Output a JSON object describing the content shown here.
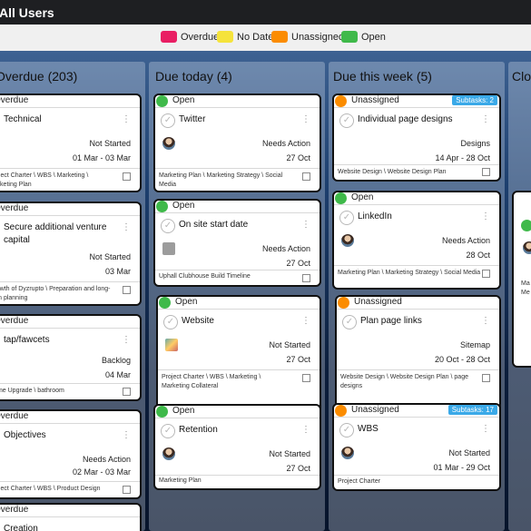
{
  "app": {
    "title": "All Users"
  },
  "legend": [
    {
      "label": "Overdue",
      "color": "#e91e63"
    },
    {
      "label": "No Date",
      "color": "#f5e33b"
    },
    {
      "label": "Unassigned",
      "color": "#fb8c00"
    },
    {
      "label": "Open",
      "color": "#3fb94a"
    }
  ],
  "columns": [
    {
      "title": "Overdue (203)"
    },
    {
      "title": "Due today (4)"
    },
    {
      "title": "Due this week (5)"
    },
    {
      "title": "Clo"
    }
  ],
  "colors": {
    "overdue": "#e91e63",
    "unassigned": "#fb8c00",
    "open": "#3fb94a",
    "subtasks": "#3aa9e8"
  },
  "cards": {
    "overdue": [
      {
        "status": "Overdue",
        "title": "Technical",
        "task_status": "Not Started",
        "date": "01 Mar - 03 Mar",
        "path": "Project Charter \\ WBS \\ Marketing \\ Marketing Plan"
      },
      {
        "status": "Overdue",
        "title": "Secure additional venture capital",
        "task_status": "Not Started",
        "date": "03 Mar",
        "path": "Growth of Dyzrupto \\ Preparation and long-term planning"
      },
      {
        "status": "Overdue",
        "title": "tap/fawcets",
        "task_status": "Backlog",
        "date": "04 Mar",
        "path": "Home Upgrade \\ bathroom"
      },
      {
        "status": "Overdue",
        "title": "Objectives",
        "task_status": "Needs Action",
        "date": "02 Mar - 03 Mar",
        "path": "Project Charter \\ WBS \\ Product Design"
      },
      {
        "status": "Overdue",
        "title": "Creation"
      }
    ],
    "today": [
      {
        "status": "Open",
        "title": "Twitter",
        "task_status": "Needs Action",
        "date": "27 Oct",
        "path": "Marketing Plan \\ Marketing Strategy \\ Social Media"
      },
      {
        "status": "Open",
        "title": "On site start date",
        "task_status": "Needs Action",
        "date": "27 Oct",
        "path": "Uphall Clubhouse Build Timeline"
      },
      {
        "status": "Open",
        "title": "Website",
        "task_status": "Not Started",
        "date": "27 Oct",
        "path": "Project Charter \\ WBS \\ Marketing \\ Marketing Collateral"
      },
      {
        "status": "Open",
        "title": "Retention",
        "task_status": "Not Started",
        "date": "27 Oct",
        "path": "Marketing Plan"
      }
    ],
    "week": [
      {
        "status": "Unassigned",
        "subtasks": "Subtasks: 2",
        "title": "Individual page designs",
        "task_status": "Designs",
        "date": "14 Apr - 28 Oct",
        "path": "Website Design \\ Website Design Plan"
      },
      {
        "status": "Open",
        "title": "LinkedIn",
        "task_status": "Needs Action",
        "date": "28 Oct",
        "path": "Marketing Plan \\ Marketing Strategy \\ Social Media"
      },
      {
        "status": "Unassigned",
        "title": "Plan page links",
        "task_status": "Sitemap",
        "date": "20 Oct - 28 Oct",
        "path": "Website Design \\ Website Design Plan \\ page designs"
      },
      {
        "status": "Unassigned",
        "subtasks": "Subtasks: 17",
        "title": "WBS",
        "task_status": "Not Started",
        "date": "01 Mar - 29 Oct",
        "path": "Project Charter"
      }
    ],
    "closed_partial": {
      "path": "Ma Me"
    }
  }
}
